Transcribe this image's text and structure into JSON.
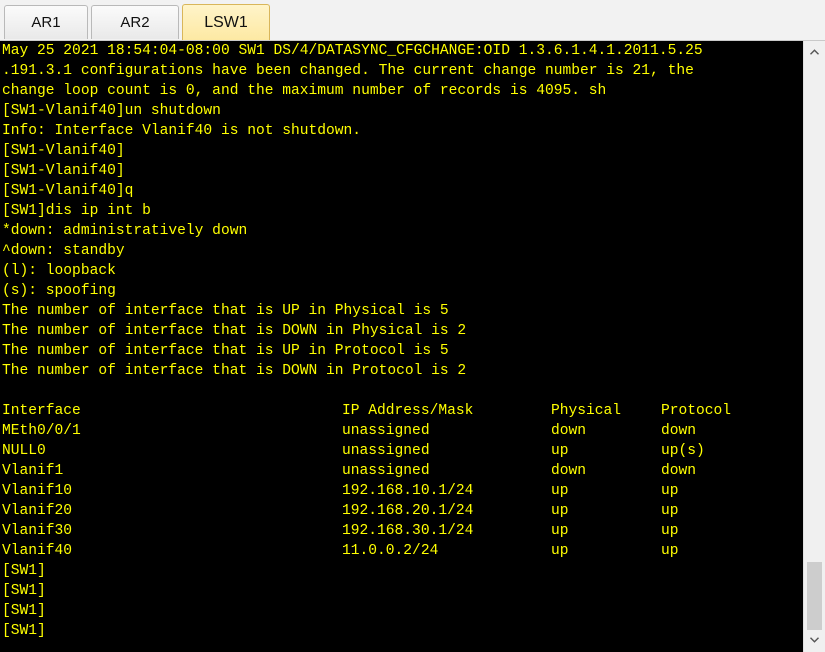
{
  "tabs": [
    {
      "label": "AR1"
    },
    {
      "label": "AR2"
    },
    {
      "label": "LSW1",
      "active": true
    }
  ],
  "terminal": {
    "text_color": "#ffff00",
    "background": "#000000",
    "lines": [
      "May 25 2021 18:54:04-08:00 SW1 DS/4/DATASYNC_CFGCHANGE:OID 1.3.6.1.4.1.2011.5.25",
      ".191.3.1 configurations have been changed. The current change number is 21, the",
      "change loop count is 0, and the maximum number of records is 4095. sh",
      "[SW1-Vlanif40]un shutdown",
      "Info: Interface Vlanif40 is not shutdown.",
      "[SW1-Vlanif40]",
      "[SW1-Vlanif40]",
      "[SW1-Vlanif40]q",
      "[SW1]dis ip int b",
      "*down: administratively down",
      "^down: standby",
      "(l): loopback",
      "(s): spoofing",
      "The number of interface that is UP in Physical is 5",
      "The number of interface that is DOWN in Physical is 2",
      "The number of interface that is UP in Protocol is 5",
      "The number of interface that is DOWN in Protocol is 2"
    ],
    "table": {
      "headers": [
        "Interface",
        "IP Address/Mask",
        "Physical",
        "Protocol"
      ],
      "rows": [
        [
          "MEth0/0/1",
          "unassigned",
          "down",
          "down"
        ],
        [
          "NULL0",
          "unassigned",
          "up",
          "up(s)"
        ],
        [
          "Vlanif1",
          "unassigned",
          "down",
          "down"
        ],
        [
          "Vlanif10",
          "192.168.10.1/24",
          "up",
          "up"
        ],
        [
          "Vlanif20",
          "192.168.20.1/24",
          "up",
          "up"
        ],
        [
          "Vlanif30",
          "192.168.30.1/24",
          "up",
          "up"
        ],
        [
          "Vlanif40",
          "11.0.0.2/24",
          "up",
          "up"
        ]
      ]
    },
    "prompts": [
      "[SW1]",
      "[SW1]",
      "[SW1]",
      "[SW1]"
    ]
  },
  "scrollbar": {
    "up_icon": "chevron-up-icon",
    "down_icon": "chevron-down-icon"
  }
}
